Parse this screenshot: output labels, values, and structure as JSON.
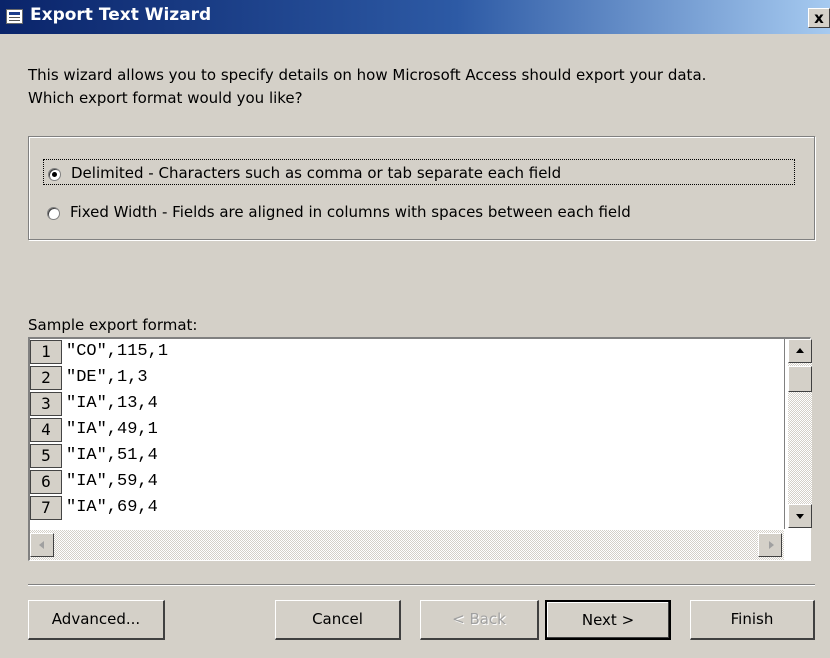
{
  "window": {
    "title": "Export Text Wizard",
    "close_glyph": "x"
  },
  "intro": {
    "line1": "This wizard allows you to specify details on how Microsoft Access should export your data.",
    "line2": "Which export format would you like?"
  },
  "format_options": [
    {
      "label": "Delimited - Characters such as comma or tab separate each field",
      "selected": true
    },
    {
      "label": "Fixed Width - Fields are aligned in columns with spaces between each field",
      "selected": false
    }
  ],
  "sample": {
    "label": "Sample export format:",
    "rows": [
      {
        "num": "1",
        "text": "\"CO\",115,1"
      },
      {
        "num": "2",
        "text": "\"DE\",1,3"
      },
      {
        "num": "3",
        "text": "\"IA\",13,4"
      },
      {
        "num": "4",
        "text": "\"IA\",49,1"
      },
      {
        "num": "5",
        "text": "\"IA\",51,4"
      },
      {
        "num": "6",
        "text": "\"IA\",59,4"
      },
      {
        "num": "7",
        "text": "\"IA\",69,4"
      }
    ]
  },
  "buttons": {
    "advanced": "Advanced...",
    "cancel": "Cancel",
    "back": "< Back",
    "next": "Next >",
    "finish": "Finish"
  },
  "icons": {
    "app": "export-wizard-icon",
    "close": "close-icon",
    "scroll_up": "scroll-up-arrow-icon",
    "scroll_down": "scroll-down-arrow-icon",
    "scroll_left": "scroll-left-arrow-icon",
    "scroll_right": "scroll-right-arrow-icon"
  },
  "colors": {
    "title_bar_start": "#0a246a",
    "title_bar_end": "#a6caf0",
    "dialog_face": "#d4d0c8"
  }
}
